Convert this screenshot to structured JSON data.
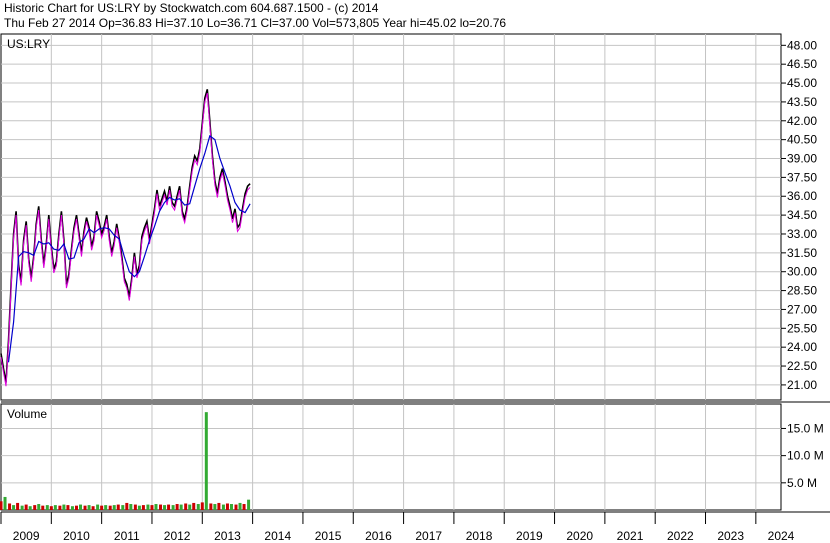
{
  "header": {
    "line1": "Historic Chart for US:LRY by Stockwatch.com 604.687.1500 - (c) 2014",
    "line2": "Thu Feb 27 2014   Op=36.83   Hi=37.10   Lo=36.71   Cl=37.00   Vol=573,805   Year hi=45.02   lo=20.76"
  },
  "chart_data": [
    {
      "type": "line",
      "title": "US:LRY",
      "ylim": [
        19.8,
        48.9
      ],
      "yticks": [
        "48.00",
        "46.50",
        "45.00",
        "43.50",
        "42.00",
        "40.50",
        "39.00",
        "37.50",
        "36.00",
        "34.50",
        "33.00",
        "31.50",
        "30.00",
        "28.50",
        "27.00",
        "25.50",
        "24.00",
        "22.50",
        "21.00"
      ],
      "x_tick_labels": [
        "2009",
        "2010",
        "2011",
        "2012",
        "2013",
        "2014",
        "2015",
        "2016",
        "2017",
        "2018",
        "2019",
        "2020",
        "2021",
        "2022",
        "2023",
        "2024"
      ],
      "xlim": [
        2009.0,
        2024.5
      ],
      "price_points": [
        [
          2009.0,
          23.5
        ],
        [
          2009.05,
          22.3
        ],
        [
          2009.1,
          21.2
        ],
        [
          2009.15,
          24.5
        ],
        [
          2009.2,
          29.0
        ],
        [
          2009.25,
          33.0
        ],
        [
          2009.3,
          34.8
        ],
        [
          2009.35,
          30.5
        ],
        [
          2009.4,
          29.2
        ],
        [
          2009.45,
          32.5
        ],
        [
          2009.5,
          34.0
        ],
        [
          2009.55,
          31.0
        ],
        [
          2009.6,
          29.5
        ],
        [
          2009.65,
          31.2
        ],
        [
          2009.7,
          33.8
        ],
        [
          2009.75,
          35.2
        ],
        [
          2009.8,
          32.5
        ],
        [
          2009.85,
          30.6
        ],
        [
          2009.9,
          32.2
        ],
        [
          2009.95,
          34.5
        ],
        [
          2010.0,
          32.0
        ],
        [
          2010.05,
          30.2
        ],
        [
          2010.1,
          30.8
        ],
        [
          2010.15,
          33.0
        ],
        [
          2010.2,
          34.8
        ],
        [
          2010.25,
          32.5
        ],
        [
          2010.3,
          29.0
        ],
        [
          2010.35,
          29.8
        ],
        [
          2010.4,
          31.8
        ],
        [
          2010.45,
          33.5
        ],
        [
          2010.5,
          34.5
        ],
        [
          2010.55,
          33.0
        ],
        [
          2010.6,
          31.5
        ],
        [
          2010.65,
          33.2
        ],
        [
          2010.7,
          34.3
        ],
        [
          2010.75,
          33.5
        ],
        [
          2010.8,
          32.0
        ],
        [
          2010.85,
          32.8
        ],
        [
          2010.9,
          34.8
        ],
        [
          2010.95,
          34.0
        ],
        [
          2011.0,
          33.0
        ],
        [
          2011.05,
          33.6
        ],
        [
          2011.1,
          34.5
        ],
        [
          2011.15,
          32.8
        ],
        [
          2011.2,
          31.5
        ],
        [
          2011.25,
          32.4
        ],
        [
          2011.3,
          33.8
        ],
        [
          2011.35,
          32.6
        ],
        [
          2011.4,
          31.2
        ],
        [
          2011.45,
          29.5
        ],
        [
          2011.5,
          29.0
        ],
        [
          2011.55,
          28.0
        ],
        [
          2011.6,
          29.5
        ],
        [
          2011.65,
          31.5
        ],
        [
          2011.7,
          29.8
        ],
        [
          2011.75,
          30.5
        ],
        [
          2011.8,
          32.8
        ],
        [
          2011.85,
          33.5
        ],
        [
          2011.9,
          34.0
        ],
        [
          2011.95,
          32.5
        ],
        [
          2012.0,
          33.8
        ],
        [
          2012.05,
          35.0
        ],
        [
          2012.1,
          36.5
        ],
        [
          2012.15,
          35.2
        ],
        [
          2012.2,
          35.8
        ],
        [
          2012.25,
          36.4
        ],
        [
          2012.3,
          35.6
        ],
        [
          2012.35,
          36.8
        ],
        [
          2012.4,
          35.5
        ],
        [
          2012.45,
          35.2
        ],
        [
          2012.5,
          36.0
        ],
        [
          2012.55,
          36.8
        ],
        [
          2012.6,
          34.8
        ],
        [
          2012.65,
          34.2
        ],
        [
          2012.7,
          35.2
        ],
        [
          2012.75,
          36.8
        ],
        [
          2012.8,
          38.3
        ],
        [
          2012.85,
          39.2
        ],
        [
          2012.9,
          38.8
        ],
        [
          2012.95,
          39.8
        ],
        [
          2013.0,
          41.8
        ],
        [
          2013.05,
          43.8
        ],
        [
          2013.1,
          44.5
        ],
        [
          2013.15,
          42.0
        ],
        [
          2013.2,
          39.2
        ],
        [
          2013.25,
          37.2
        ],
        [
          2013.3,
          36.2
        ],
        [
          2013.35,
          37.5
        ],
        [
          2013.4,
          38.2
        ],
        [
          2013.45,
          37.2
        ],
        [
          2013.5,
          36.0
        ],
        [
          2013.55,
          35.2
        ],
        [
          2013.6,
          34.2
        ],
        [
          2013.65,
          35.0
        ],
        [
          2013.7,
          33.5
        ],
        [
          2013.75,
          33.8
        ],
        [
          2013.8,
          35.0
        ],
        [
          2013.85,
          36.2
        ],
        [
          2013.9,
          36.8
        ],
        [
          2013.95,
          37.0
        ]
      ],
      "moving_average_points": [
        [
          2009.15,
          22.8
        ],
        [
          2009.25,
          26.0
        ],
        [
          2009.35,
          31.2
        ],
        [
          2009.45,
          31.6
        ],
        [
          2009.55,
          31.5
        ],
        [
          2009.65,
          31.3
        ],
        [
          2009.75,
          32.4
        ],
        [
          2009.85,
          32.2
        ],
        [
          2009.95,
          32.3
        ],
        [
          2010.05,
          31.8
        ],
        [
          2010.15,
          31.7
        ],
        [
          2010.25,
          32.2
        ],
        [
          2010.35,
          31.0
        ],
        [
          2010.45,
          31.1
        ],
        [
          2010.55,
          32.3
        ],
        [
          2010.65,
          32.6
        ],
        [
          2010.75,
          33.4
        ],
        [
          2010.85,
          33.1
        ],
        [
          2010.95,
          33.4
        ],
        [
          2011.05,
          33.5
        ],
        [
          2011.15,
          33.4
        ],
        [
          2011.25,
          32.9
        ],
        [
          2011.35,
          32.6
        ],
        [
          2011.45,
          31.2
        ],
        [
          2011.55,
          30.0
        ],
        [
          2011.65,
          29.6
        ],
        [
          2011.75,
          30.0
        ],
        [
          2011.85,
          31.2
        ],
        [
          2011.95,
          32.5
        ],
        [
          2012.05,
          33.6
        ],
        [
          2012.15,
          34.8
        ],
        [
          2012.25,
          35.5
        ],
        [
          2012.35,
          35.9
        ],
        [
          2012.45,
          35.7
        ],
        [
          2012.55,
          35.8
        ],
        [
          2012.65,
          35.3
        ],
        [
          2012.75,
          35.4
        ],
        [
          2012.85,
          36.8
        ],
        [
          2012.95,
          38.2
        ],
        [
          2013.05,
          39.4
        ],
        [
          2013.15,
          40.8
        ],
        [
          2013.25,
          40.5
        ],
        [
          2013.35,
          39.0
        ],
        [
          2013.45,
          37.9
        ],
        [
          2013.55,
          36.8
        ],
        [
          2013.65,
          35.5
        ],
        [
          2013.75,
          34.9
        ],
        [
          2013.85,
          34.7
        ],
        [
          2013.95,
          35.4
        ]
      ]
    },
    {
      "type": "bar",
      "title": "Volume",
      "ylim": [
        0,
        19.5
      ],
      "yticks": [
        "15.0 M",
        "10.0 M",
        "5.0 M"
      ],
      "x_tick_labels": [
        "2009",
        "2010",
        "2011",
        "2012",
        "2013",
        "2014",
        "2015",
        "2016",
        "2017",
        "2018",
        "2019",
        "2020",
        "2021",
        "2022",
        "2023",
        "2024"
      ],
      "volume_points_m": [
        [
          2009.0,
          1.6
        ],
        [
          2009.08,
          2.4
        ],
        [
          2009.17,
          1.2
        ],
        [
          2009.25,
          0.9
        ],
        [
          2009.33,
          1.3
        ],
        [
          2009.42,
          0.8
        ],
        [
          2009.5,
          1.0
        ],
        [
          2009.58,
          0.7
        ],
        [
          2009.67,
          0.9
        ],
        [
          2009.75,
          1.1
        ],
        [
          2009.83,
          0.8
        ],
        [
          2009.92,
          0.9
        ],
        [
          2010.0,
          0.7
        ],
        [
          2010.08,
          0.9
        ],
        [
          2010.17,
          0.8
        ],
        [
          2010.25,
          1.0
        ],
        [
          2010.33,
          0.9
        ],
        [
          2010.42,
          0.7
        ],
        [
          2010.5,
          0.8
        ],
        [
          2010.58,
          1.0
        ],
        [
          2010.67,
          0.8
        ],
        [
          2010.75,
          0.9
        ],
        [
          2010.83,
          0.7
        ],
        [
          2010.92,
          1.0
        ],
        [
          2011.0,
          0.8
        ],
        [
          2011.08,
          0.9
        ],
        [
          2011.17,
          0.8
        ],
        [
          2011.25,
          0.9
        ],
        [
          2011.33,
          1.0
        ],
        [
          2011.42,
          0.9
        ],
        [
          2011.5,
          1.3
        ],
        [
          2011.58,
          1.1
        ],
        [
          2011.67,
          1.0
        ],
        [
          2011.75,
          0.8
        ],
        [
          2011.83,
          0.9
        ],
        [
          2011.92,
          1.0
        ],
        [
          2012.0,
          0.9
        ],
        [
          2012.08,
          1.1
        ],
        [
          2012.17,
          1.0
        ],
        [
          2012.25,
          0.9
        ],
        [
          2012.33,
          1.0
        ],
        [
          2012.42,
          0.9
        ],
        [
          2012.5,
          1.1
        ],
        [
          2012.58,
          1.0
        ],
        [
          2012.67,
          1.2
        ],
        [
          2012.75,
          1.0
        ],
        [
          2012.83,
          1.3
        ],
        [
          2012.92,
          1.1
        ],
        [
          2013.0,
          1.4
        ],
        [
          2013.08,
          18.0
        ],
        [
          2013.17,
          1.2
        ],
        [
          2013.25,
          1.1
        ],
        [
          2013.33,
          1.3
        ],
        [
          2013.42,
          1.0
        ],
        [
          2013.5,
          1.2
        ],
        [
          2013.58,
          1.1
        ],
        [
          2013.67,
          1.0
        ],
        [
          2013.75,
          1.3
        ],
        [
          2013.83,
          1.1
        ],
        [
          2013.92,
          1.9
        ]
      ]
    }
  ]
}
